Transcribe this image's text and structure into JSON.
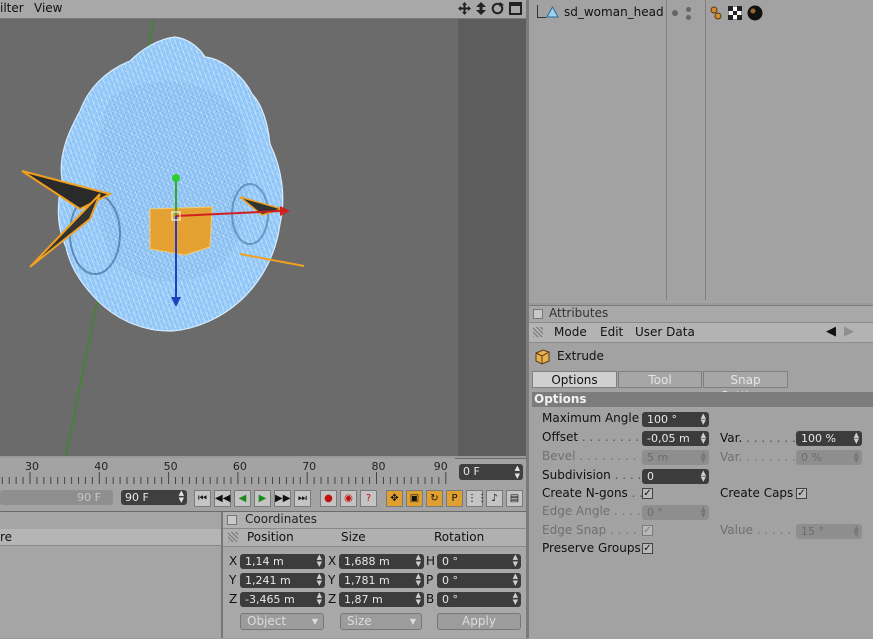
{
  "viewport": {
    "menu": {
      "filter": "ilter",
      "view": "View"
    },
    "nav_icons": [
      "move-icon",
      "zoom-icon",
      "rotate-icon",
      "maximize-icon"
    ]
  },
  "timeline": {
    "ticks": [
      "30",
      "40",
      "50",
      "60",
      "70",
      "80",
      "90"
    ],
    "current_frame": "0 F",
    "end_frame_ghost": "90 F",
    "end_frame": "90 F"
  },
  "left_panel": {
    "header_label": "re"
  },
  "coordinates": {
    "title": "Coordinates",
    "col_position": "Position",
    "col_size": "Size",
    "col_rotation": "Rotation",
    "rows": [
      {
        "pos_axis": "X",
        "pos": "1,14 m",
        "size_axis": "X",
        "size": "1,688 m",
        "rot_axis": "H",
        "rot": "0 °"
      },
      {
        "pos_axis": "Y",
        "pos": "1,241 m",
        "size_axis": "Y",
        "size": "1,781 m",
        "rot_axis": "P",
        "rot": "0 °"
      },
      {
        "pos_axis": "Z",
        "pos": "-3,465 m",
        "size_axis": "Z",
        "size": "1,87 m",
        "rot_axis": "B",
        "rot": "0 °"
      }
    ],
    "mode_select": "Object",
    "size_select": "Size",
    "apply": "Apply"
  },
  "object_manager": {
    "object_name": "sd_woman_head"
  },
  "attributes": {
    "title": "Attributes",
    "menu": {
      "mode": "Mode",
      "edit": "Edit",
      "user_data": "User Data"
    },
    "object_type": "Extrude",
    "tabs": [
      "Options",
      "Tool",
      "Snap Settings"
    ],
    "section": "Options",
    "max_angle_label": "Maximum Angle",
    "max_angle": "100 °",
    "offset_label": "Offset",
    "offset": "-0,05 m",
    "offset_var_label": "Var.",
    "offset_var": "100 %",
    "bevel_label": "Bevel",
    "bevel": "5 m",
    "bevel_var_label": "Var.",
    "bevel_var": "0 %",
    "subdivision_label": "Subdivision",
    "subdivision": "0",
    "create_ngons_label": "Create N-gons",
    "create_caps_label": "Create Caps",
    "edge_angle_label": "Edge Angle",
    "edge_angle": "0 °",
    "edge_snap_label": "Edge Snap",
    "value_label": "Value",
    "value": "15 °",
    "preserve_groups_label": "Preserve Groups",
    "check_mark": "✓"
  }
}
